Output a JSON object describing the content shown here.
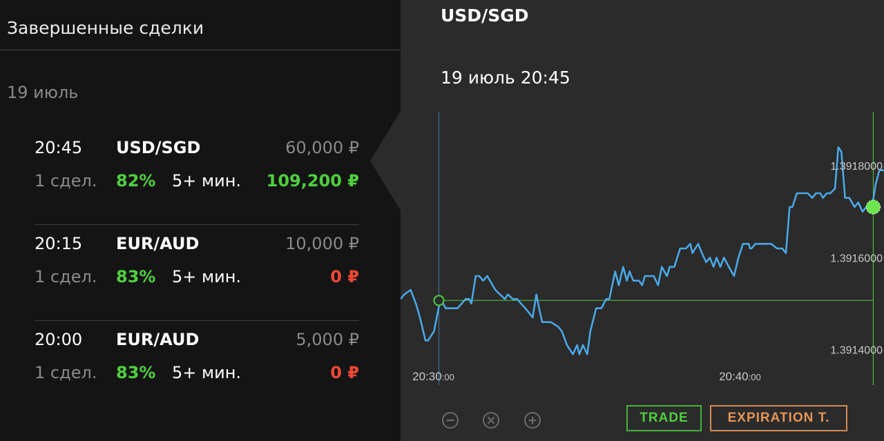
{
  "left_panel": {
    "title": "Завершенные сделки",
    "date_group": "19 июль",
    "trades": [
      {
        "time": "20:45",
        "pair": "USD/SGD",
        "amount": "60,000 ₽",
        "count": "1 сдел.",
        "percent": "82%",
        "duration": "5+ мин.",
        "payout": "109,200 ₽",
        "payout_status": "win"
      },
      {
        "time": "20:15",
        "pair": "EUR/AUD",
        "amount": "10,000 ₽",
        "count": "1 сдел.",
        "percent": "83%",
        "duration": "5+ мин.",
        "payout": "0 ₽",
        "payout_status": "loss"
      },
      {
        "time": "20:00",
        "pair": "EUR/AUD",
        "amount": "5,000 ₽",
        "count": "1 сдел.",
        "percent": "83%",
        "duration": "5+ мин.",
        "payout": "0 ₽",
        "payout_status": "loss"
      }
    ]
  },
  "right_panel": {
    "pair": "USD/SGD",
    "datetime": "19 июль 20:45",
    "buttons": {
      "trade": "TRADE",
      "expiration": "EXPIRATION T."
    },
    "controls": [
      "zoom-out-icon",
      "fit-icon",
      "zoom-in-icon"
    ]
  },
  "colors": {
    "win": "#4fcf3f",
    "loss": "#ef4836",
    "line": "#4aa8e6",
    "entry": "#4fcf3f"
  },
  "chart_data": {
    "type": "line",
    "x_tick_labels": [
      {
        "main": "20:30",
        "sub": ":00",
        "value": 0
      },
      {
        "main": "20:40",
        "sub": ":00",
        "value": 10
      }
    ],
    "y_tick_labels": [
      {
        "label": "1.3918000",
        "value": 1.3918
      },
      {
        "label": "1.3916000",
        "value": 1.3916
      },
      {
        "label": "1.3914000",
        "value": 1.3914
      }
    ],
    "x_unit": "minutes after 20:30",
    "xlim": [
      -1.07,
      14.7
    ],
    "ylim": [
      1.39132,
      1.39192
    ],
    "entry": {
      "x": 0.18,
      "y": 1.391507
    },
    "expiry": {
      "x": 14.35,
      "y": 1.39171
    },
    "series": [
      {
        "x": [
          -1.07,
          -0.95,
          -0.74,
          -0.57,
          -0.48,
          -0.4,
          -0.26,
          -0.17,
          0.02,
          0.23,
          0.4,
          0.53,
          0.64,
          0.79,
          1.05,
          1.17,
          1.24,
          1.38,
          1.5,
          1.62,
          1.76,
          2.02,
          2.33,
          2.43,
          2.59,
          2.74,
          2.86,
          3.0,
          3.24,
          3.36,
          3.45,
          3.55,
          3.69,
          3.83,
          4.07,
          4.19,
          4.36,
          4.55,
          4.69,
          4.76,
          4.88,
          5.02,
          5.12,
          5.31,
          5.48,
          5.64,
          5.74,
          5.93,
          6.05,
          6.19,
          6.31,
          6.4,
          6.52,
          6.71,
          6.81,
          6.9,
          7.02,
          7.19,
          7.33,
          7.45,
          7.62,
          7.71,
          7.86,
          8.05,
          8.24,
          8.38,
          8.45,
          8.64,
          8.76,
          8.9,
          9.02,
          9.14,
          9.24,
          9.36,
          9.48,
          9.64,
          9.81,
          9.95,
          10.1,
          10.29,
          10.33,
          10.38,
          10.5,
          10.6,
          10.74,
          10.86,
          11.02,
          11.21,
          11.38,
          11.5,
          11.62,
          11.71,
          11.86,
          11.95,
          12.07,
          12.21,
          12.36,
          12.48,
          12.62,
          12.71,
          12.83,
          12.95,
          13.1,
          13.21,
          13.31,
          13.43,
          13.57,
          13.74,
          13.86,
          14.0,
          14.12,
          14.21,
          14.31,
          14.43,
          14.55,
          14.64,
          14.7
        ],
        "values": [
          1.39151,
          1.39152,
          1.39153,
          1.3915,
          1.39148,
          1.39146,
          1.39142,
          1.39142,
          1.39144,
          1.39151,
          1.39149,
          1.39149,
          1.39149,
          1.39149,
          1.39151,
          1.39151,
          1.3915,
          1.39156,
          1.39156,
          1.39155,
          1.39156,
          1.39153,
          1.39151,
          1.39152,
          1.39151,
          1.39151,
          1.3915,
          1.39149,
          1.39147,
          1.39152,
          1.39149,
          1.39146,
          1.39146,
          1.39146,
          1.39145,
          1.39144,
          1.39141,
          1.39139,
          1.39141,
          1.39139,
          1.39141,
          1.39139,
          1.39144,
          1.39149,
          1.39149,
          1.39151,
          1.39151,
          1.39157,
          1.39154,
          1.39158,
          1.39155,
          1.39157,
          1.39155,
          1.39155,
          1.39154,
          1.39156,
          1.39156,
          1.39156,
          1.39154,
          1.39158,
          1.39156,
          1.39158,
          1.39158,
          1.39162,
          1.39162,
          1.39163,
          1.39161,
          1.39163,
          1.39161,
          1.39159,
          1.3916,
          1.39158,
          1.3916,
          1.39158,
          1.3916,
          1.39158,
          1.39156,
          1.3916,
          1.39163,
          1.39163,
          1.39162,
          1.39162,
          1.39163,
          1.39163,
          1.39163,
          1.39163,
          1.39163,
          1.39162,
          1.39162,
          1.39161,
          1.39171,
          1.39171,
          1.39174,
          1.39174,
          1.39174,
          1.39174,
          1.39173,
          1.39174,
          1.39174,
          1.39173,
          1.39174,
          1.39174,
          1.39175,
          1.39184,
          1.39183,
          1.39173,
          1.39173,
          1.39171,
          1.39172,
          1.3917,
          1.39171,
          1.3917,
          1.39171,
          1.39176,
          1.39179,
          1.39179,
          1.39179
        ]
      }
    ]
  }
}
